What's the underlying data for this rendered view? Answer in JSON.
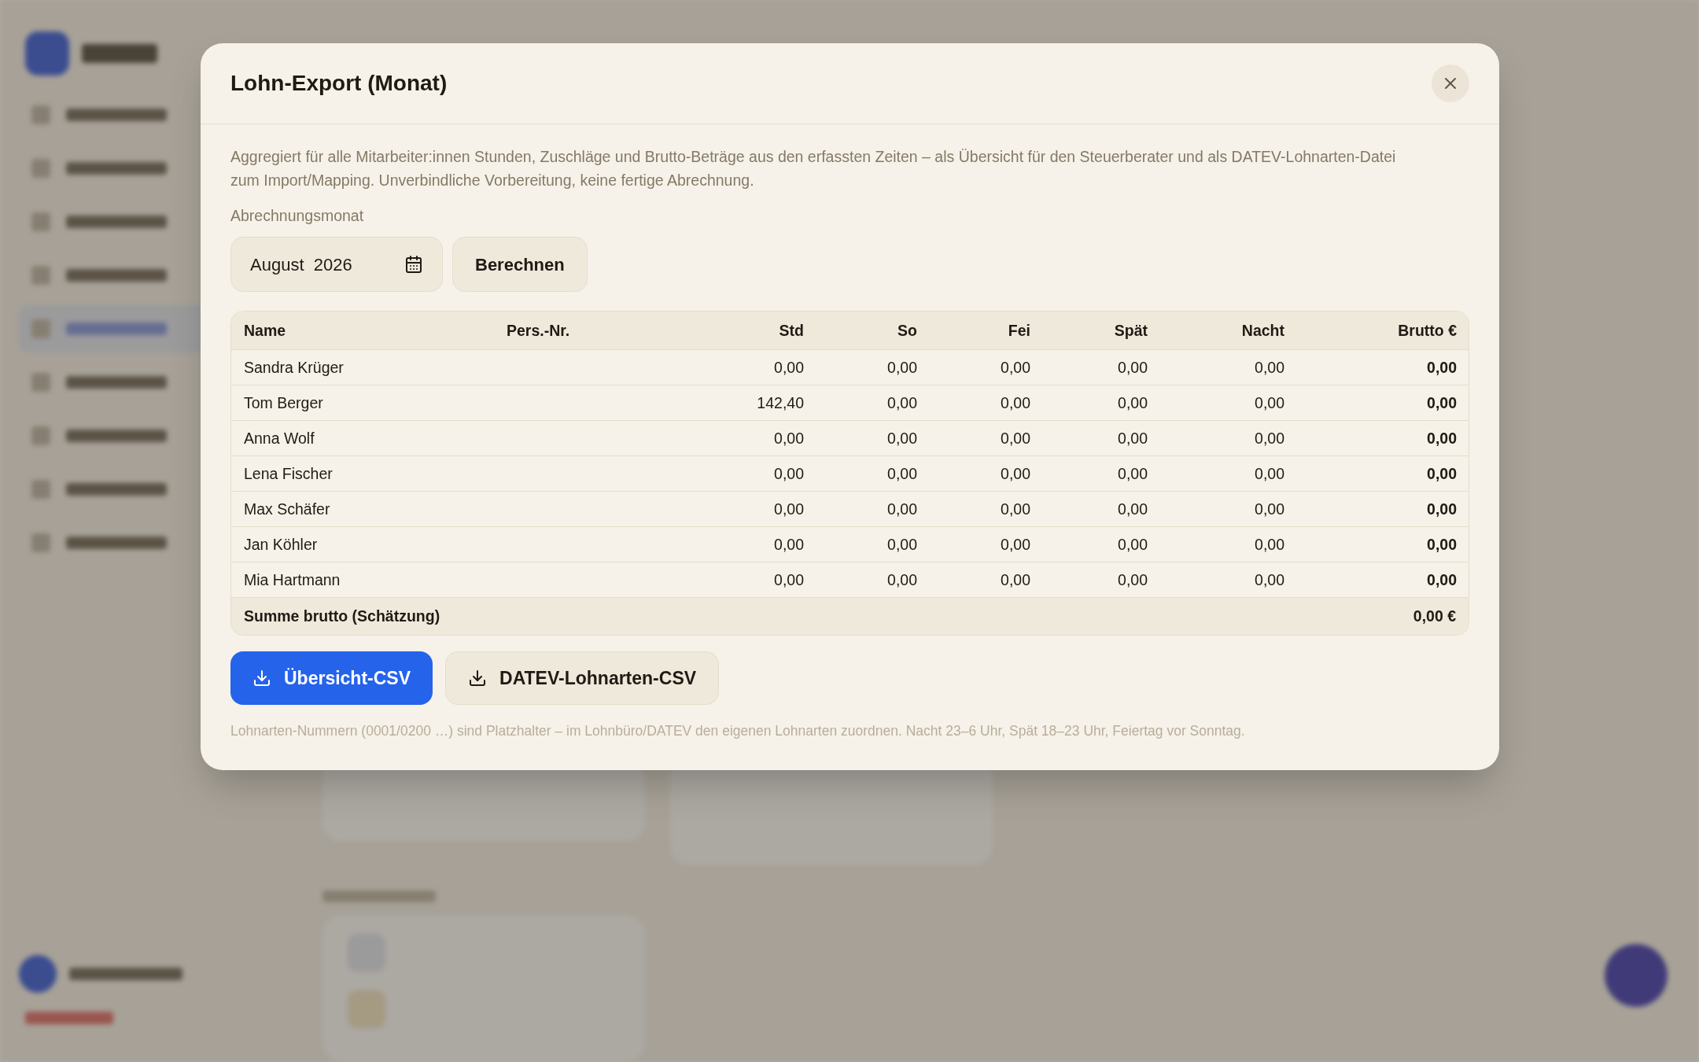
{
  "dialog": {
    "title": "Lohn-Export (Monat)",
    "description": "Aggregiert für alle Mitarbeiter:innen Stunden, Zuschläge und Brutto-Beträge aus den erfassten Zeiten – als Übersicht für den Steuerberater und als DATEV-Lohnarten-Datei zum Import/Mapping. Unverbindliche Vorbereitung, keine fertige Abrechnung.",
    "month_label": "Abrechnungsmonat",
    "month_value": "August  2026",
    "calculate_button": "Berechnen",
    "table": {
      "columns": [
        "Name",
        "Pers.-Nr.",
        "Std",
        "So",
        "Fei",
        "Spät",
        "Nacht",
        "Brutto €"
      ],
      "rows": [
        [
          "Sandra Krüger",
          "",
          "0,00",
          "0,00",
          "0,00",
          "0,00",
          "0,00",
          "0,00"
        ],
        [
          "Tom Berger",
          "",
          "142,40",
          "0,00",
          "0,00",
          "0,00",
          "0,00",
          "0,00"
        ],
        [
          "Anna Wolf",
          "",
          "0,00",
          "0,00",
          "0,00",
          "0,00",
          "0,00",
          "0,00"
        ],
        [
          "Lena Fischer",
          "",
          "0,00",
          "0,00",
          "0,00",
          "0,00",
          "0,00",
          "0,00"
        ],
        [
          "Max Schäfer",
          "",
          "0,00",
          "0,00",
          "0,00",
          "0,00",
          "0,00",
          "0,00"
        ],
        [
          "Jan Köhler",
          "",
          "0,00",
          "0,00",
          "0,00",
          "0,00",
          "0,00",
          "0,00"
        ],
        [
          "Mia Hartmann",
          "",
          "0,00",
          "0,00",
          "0,00",
          "0,00",
          "0,00",
          "0,00"
        ]
      ],
      "total_label": "Summe brutto (Schätzung)",
      "total_value": "0,00 €"
    },
    "buttons": [
      {
        "label": "Übersicht-CSV",
        "kind": "primary"
      },
      {
        "label": "DATEV-Lohnarten-CSV",
        "kind": "secondary"
      }
    ],
    "footnote": "Lohnarten-Nummern (0001/0200 …) sind Platzhalter – im Lohnbüro/DATEV den eigenen Lohnarten zuordnen. Nacht 23–6 Uhr, Spät 18–23 Uhr, Feiertag vor Sonntag."
  }
}
